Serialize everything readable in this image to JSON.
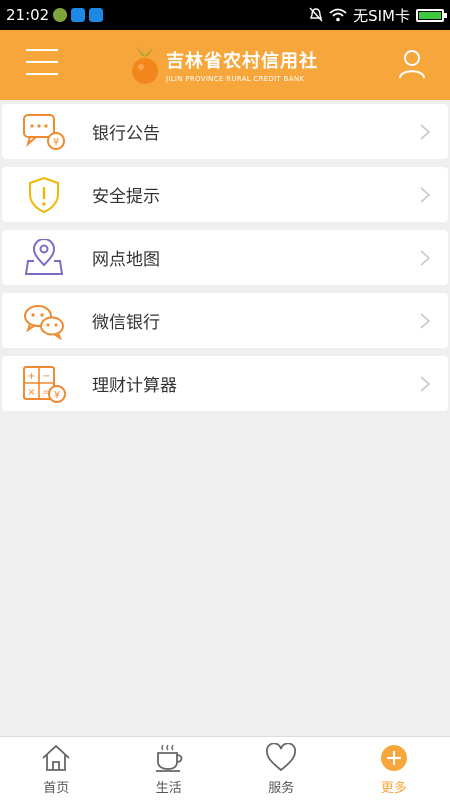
{
  "status_bar": {
    "time": "21:02",
    "carrier": "无SIM卡"
  },
  "header": {
    "brand_cn": "吉林省农村信用社",
    "brand_en": "JILIN PROVINCE RURAL CREDIT BANK"
  },
  "menu": [
    {
      "label": "银行公告",
      "icon": "announcement-icon"
    },
    {
      "label": "安全提示",
      "icon": "security-shield-icon"
    },
    {
      "label": "网点地图",
      "icon": "map-pin-icon"
    },
    {
      "label": "微信银行",
      "icon": "wechat-icon"
    },
    {
      "label": "理财计算器",
      "icon": "calculator-icon"
    }
  ],
  "tabs": [
    {
      "label": "首页",
      "icon": "home-icon"
    },
    {
      "label": "生活",
      "icon": "coffee-icon"
    },
    {
      "label": "服务",
      "icon": "heart-icon"
    },
    {
      "label": "更多",
      "icon": "plus-icon",
      "active": true
    }
  ],
  "colors": {
    "accent": "#f6a63a",
    "background": "#efefef",
    "shield": "#f2b705",
    "map": "#7b6cc7",
    "orange_icon": "#f08a30"
  }
}
